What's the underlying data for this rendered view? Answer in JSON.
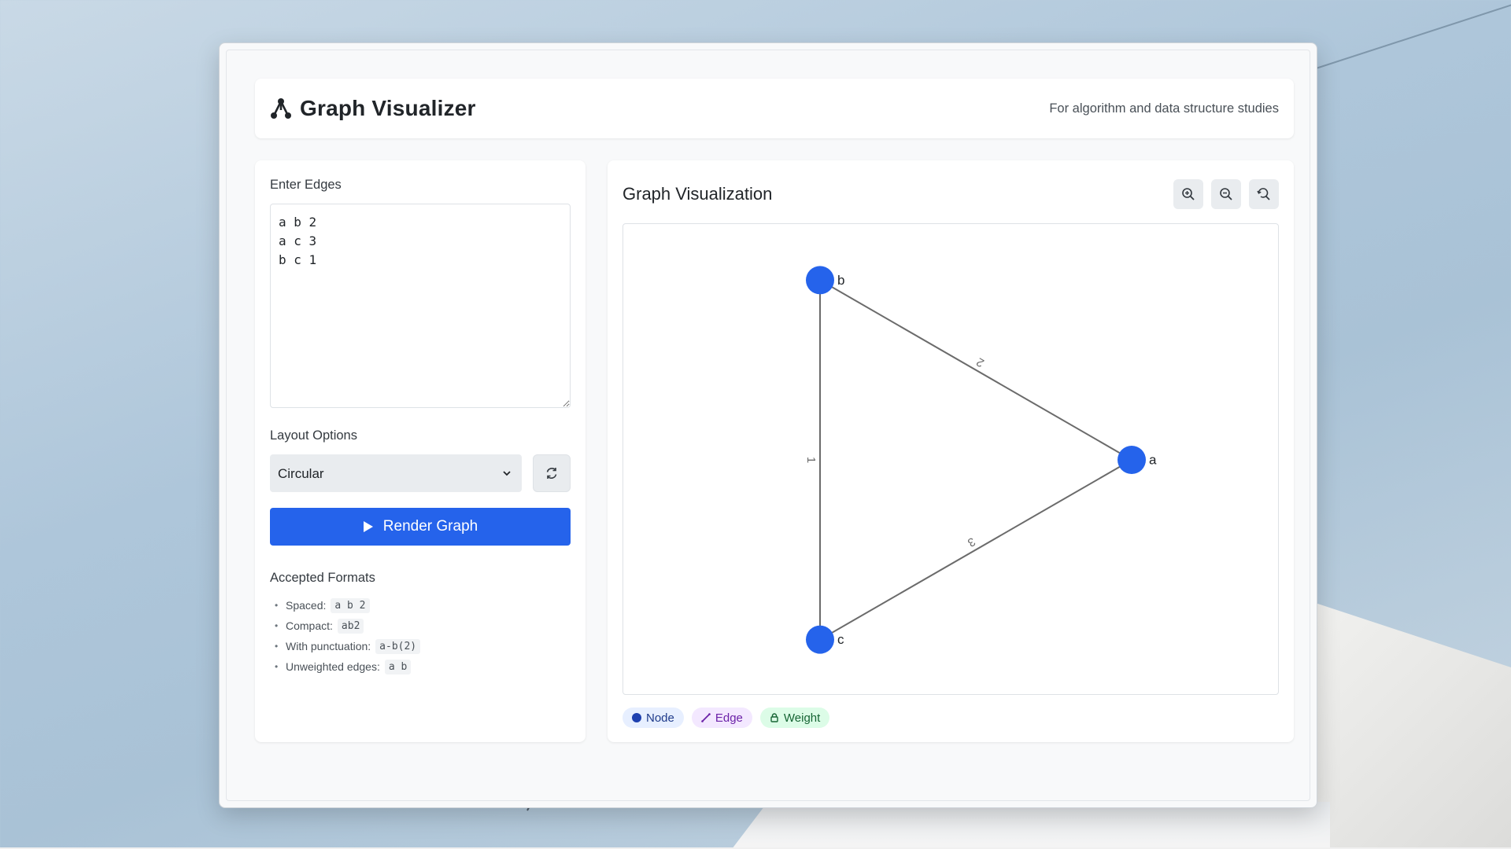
{
  "header": {
    "title": "Graph Visualizer",
    "subtitle": "For algorithm and data structure studies"
  },
  "input": {
    "label": "Enter Edges",
    "value": "a b 2\na c 3\nb c 1"
  },
  "layout": {
    "label": "Layout Options",
    "selected": "Circular"
  },
  "render_button": {
    "label": "Render Graph"
  },
  "formats": {
    "title": "Accepted Formats",
    "items": [
      {
        "label": "Spaced:",
        "code": "a b 2"
      },
      {
        "label": "Compact:",
        "code": "ab2"
      },
      {
        "label": "With punctuation:",
        "code": "a-b(2)"
      },
      {
        "label": "Unweighted edges:",
        "code": "a b"
      }
    ]
  },
  "visualization": {
    "title": "Graph Visualization",
    "nodes": [
      {
        "id": "a",
        "label": "a"
      },
      {
        "id": "b",
        "label": "b"
      },
      {
        "id": "c",
        "label": "c"
      }
    ],
    "edges": [
      {
        "from": "a",
        "to": "b",
        "weight": "2"
      },
      {
        "from": "a",
        "to": "c",
        "weight": "3"
      },
      {
        "from": "b",
        "to": "c",
        "weight": "1"
      }
    ],
    "node_color": "#2563eb",
    "edge_color": "#6b6b6b"
  },
  "legend": {
    "node": "Node",
    "edge": "Edge",
    "weight": "Weight"
  },
  "colors": {
    "accent": "#2563eb"
  }
}
